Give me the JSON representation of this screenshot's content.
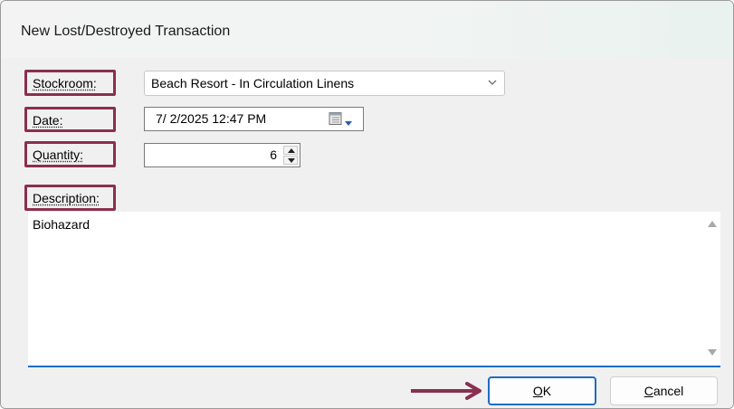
{
  "window": {
    "title": "New Lost/Destroyed Transaction"
  },
  "fields": {
    "stockroom": {
      "label": "Stockroom:",
      "value": "Beach Resort - In Circulation Linens"
    },
    "date": {
      "label": "Date:",
      "value": "7/  2/2025 12:47 PM"
    },
    "quantity": {
      "label": "Quantity:",
      "value": "6"
    },
    "description": {
      "label": "Description:",
      "value": "Biohazard"
    }
  },
  "buttons": {
    "ok": {
      "mnemonic": "O",
      "rest": "K"
    },
    "cancel": {
      "mnemonic": "C",
      "rest": "ancel"
    }
  },
  "icons": {
    "combo": "chevron-down-icon",
    "date": "calendar-icon",
    "spin_up": "triangle-up-icon",
    "spin_down": "triangle-down-icon",
    "scroll_up": "scroll-up-icon",
    "scroll_down": "scroll-down-icon",
    "annotation": "arrow-right-icon"
  },
  "colors": {
    "highlight": "#8a2f4f",
    "accent": "#1f6cc1",
    "arrow": "#8a2f4f"
  }
}
